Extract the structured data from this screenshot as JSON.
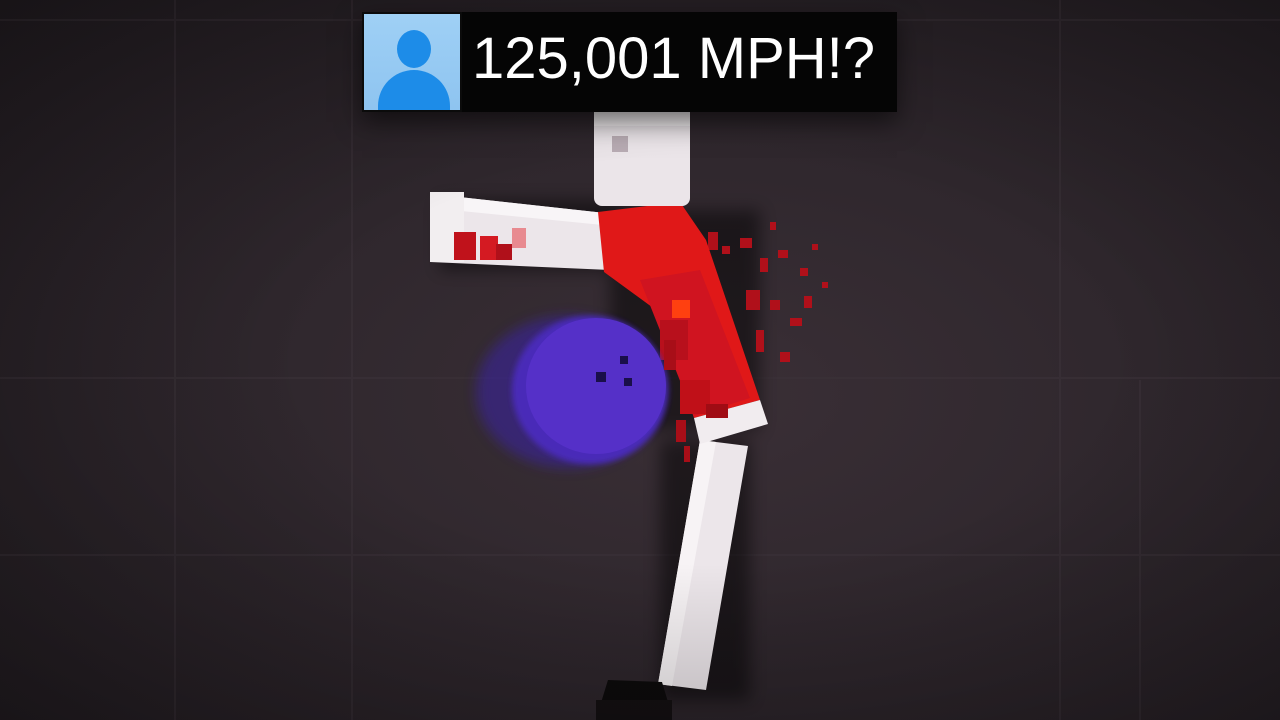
{
  "caption": {
    "text": "125,001 MPH!?"
  },
  "icons": {
    "avatar": "user-avatar-icon"
  },
  "colors": {
    "background": "#2f272d",
    "ragdoll_skin": "#ece6ea",
    "shirt": "#e01818",
    "ball": "#4a2bb8",
    "blood": "#b0101a",
    "avatar_bg": "#9fd0f5",
    "avatar_figure": "#1d8ce8"
  }
}
